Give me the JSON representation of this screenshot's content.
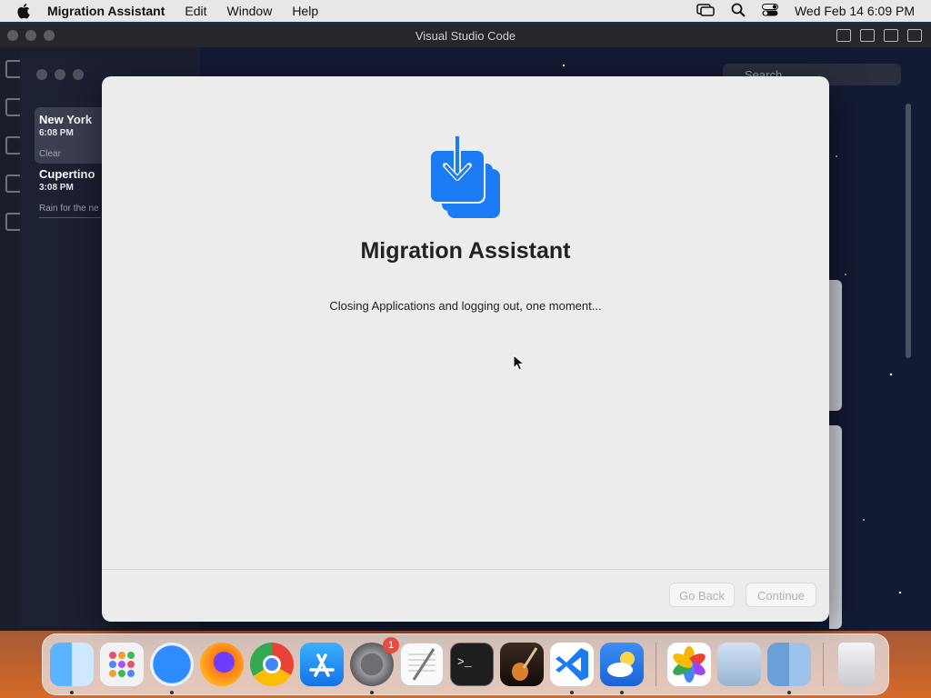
{
  "menubar": {
    "app_name": "Migration Assistant",
    "items": [
      "Edit",
      "Window",
      "Help"
    ],
    "datetime": "Wed Feb 14  6:09 PM"
  },
  "vscode": {
    "title": "Visual Studio Code",
    "search_placeholder": "Search"
  },
  "weather": {
    "locations": [
      {
        "city": "New York",
        "time": "6:08 PM",
        "condition": "Clear"
      },
      {
        "city": "Cupertino",
        "time": "3:08 PM",
        "condition": "Rain for the ne"
      }
    ]
  },
  "migration_assistant": {
    "heading": "Migration Assistant",
    "status": "Closing Applications and logging out, one moment...",
    "go_back_label": "Go Back",
    "continue_label": "Continue"
  },
  "dock": {
    "apps": [
      {
        "name": "finder-icon",
        "running": true
      },
      {
        "name": "launchpad-icon",
        "running": false
      },
      {
        "name": "safari-icon",
        "running": true
      },
      {
        "name": "firefox-icon",
        "running": false
      },
      {
        "name": "chrome-icon",
        "running": false
      },
      {
        "name": "app-store-icon",
        "running": false
      },
      {
        "name": "system-settings-icon",
        "running": true,
        "badge": "1"
      },
      {
        "name": "textedit-icon",
        "running": false
      },
      {
        "name": "terminal-icon",
        "running": false
      },
      {
        "name": "garageband-icon",
        "running": false
      },
      {
        "name": "vscode-icon",
        "running": true
      },
      {
        "name": "weather-icon",
        "running": true
      },
      {
        "name": "photos-icon",
        "running": false
      },
      {
        "name": "preview-icon",
        "running": false
      },
      {
        "name": "migration-assistant-icon",
        "running": true
      },
      {
        "name": "trash-icon",
        "running": false
      }
    ]
  },
  "colors": {
    "accent_blue": "#1a7bf2",
    "menubar": "#e7e7e7",
    "dialog_bg": "#ececec"
  }
}
